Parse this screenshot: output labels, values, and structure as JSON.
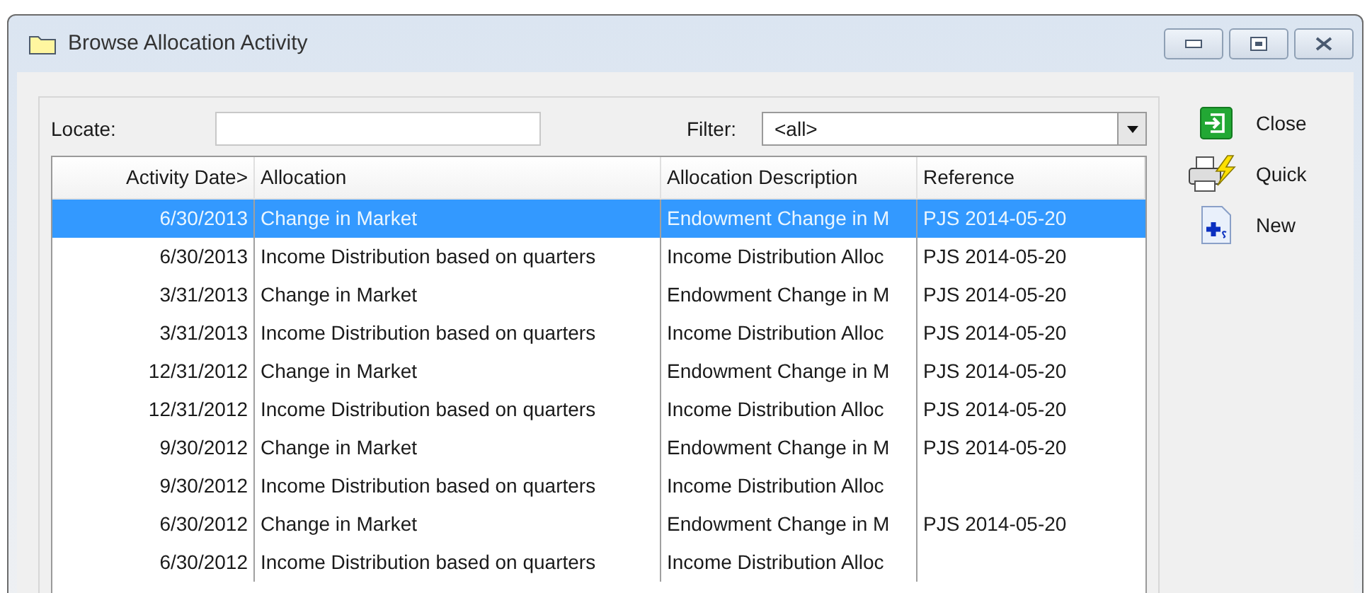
{
  "window": {
    "title": "Browse Allocation Activity"
  },
  "locate": {
    "label": "Locate:"
  },
  "filter": {
    "label": "Filter:",
    "value": "<all>"
  },
  "table": {
    "columns": [
      "Activity Date>",
      "Allocation",
      "Allocation Description",
      "Reference"
    ],
    "rows": [
      {
        "selected": true,
        "cells": [
          "6/30/2013",
          "Change in Market",
          "Endowment Change in M",
          "PJS 2014-05-20"
        ]
      },
      {
        "selected": false,
        "cells": [
          "6/30/2013",
          "Income Distribution based on quarters",
          "Income Distribution Alloc",
          "PJS 2014-05-20"
        ]
      },
      {
        "selected": false,
        "cells": [
          "3/31/2013",
          "Change in Market",
          "Endowment Change in M",
          "PJS 2014-05-20"
        ]
      },
      {
        "selected": false,
        "cells": [
          "3/31/2013",
          "Income Distribution based on quarters",
          "Income Distribution Alloc",
          "PJS 2014-05-20"
        ]
      },
      {
        "selected": false,
        "cells": [
          "12/31/2012",
          "Change in Market",
          "Endowment Change in M",
          "PJS 2014-05-20"
        ]
      },
      {
        "selected": false,
        "cells": [
          "12/31/2012",
          "Income Distribution based on quarters",
          "Income Distribution Alloc",
          "PJS 2014-05-20"
        ]
      },
      {
        "selected": false,
        "cells": [
          "9/30/2012",
          "Change in Market",
          "Endowment Change in M",
          "PJS 2014-05-20"
        ]
      },
      {
        "selected": false,
        "cells": [
          "9/30/2012",
          "Income Distribution based on quarters",
          "Income Distribution Alloc",
          ""
        ]
      },
      {
        "selected": false,
        "cells": [
          "6/30/2012",
          "Change in Market",
          "Endowment Change in M",
          "PJS 2014-05-20"
        ]
      },
      {
        "selected": false,
        "cells": [
          "6/30/2012",
          "Income Distribution based on quarters",
          "Income Distribution Alloc",
          ""
        ]
      }
    ]
  },
  "actions": [
    {
      "kind": "close",
      "label": "Close"
    },
    {
      "kind": "quick",
      "label": "Quick"
    },
    {
      "kind": "new",
      "label": "New"
    }
  ]
}
